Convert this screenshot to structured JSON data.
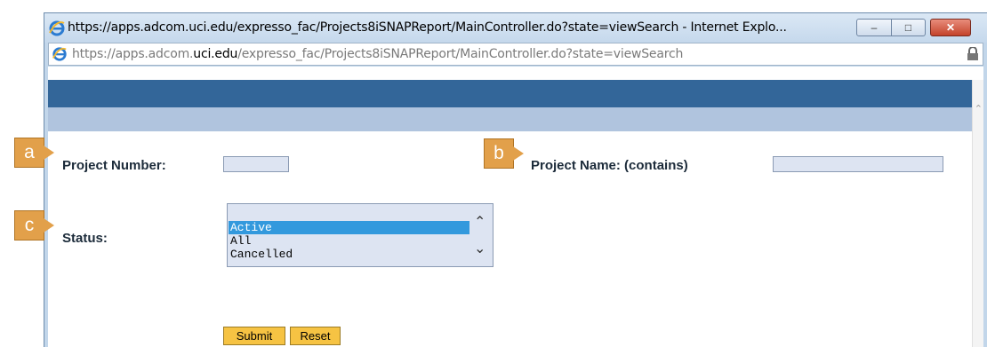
{
  "window": {
    "title": "https://apps.adcom.uci.edu/expresso_fac/Projects8iSNAPReport/MainController.do?state=viewSearch - Internet Explo...",
    "min_glyph": "–",
    "max_glyph": "□",
    "close_glyph": "✕"
  },
  "address": {
    "prefix": "https://apps.adcom.",
    "domain": "uci.edu",
    "suffix": "/expresso_fac/Projects8iSNAPReport/MainController.do?state=viewSearch"
  },
  "form": {
    "project_number_label": "Project Number:",
    "project_name_label": "Project Name: (contains)",
    "status_label": "Status:",
    "project_number_value": "",
    "project_name_value": "",
    "status_options": [
      "Active",
      "All",
      "Cancelled"
    ],
    "status_selected": "Active",
    "submit_label": "Submit",
    "reset_label": "Reset"
  },
  "callouts": {
    "a": "a",
    "b": "b",
    "c": "c"
  },
  "colors": {
    "header_band": "#336699",
    "subheader_band": "#b0c4de",
    "button": "#f6c343",
    "callout": "#e2a04a",
    "selection": "#3399dd"
  }
}
